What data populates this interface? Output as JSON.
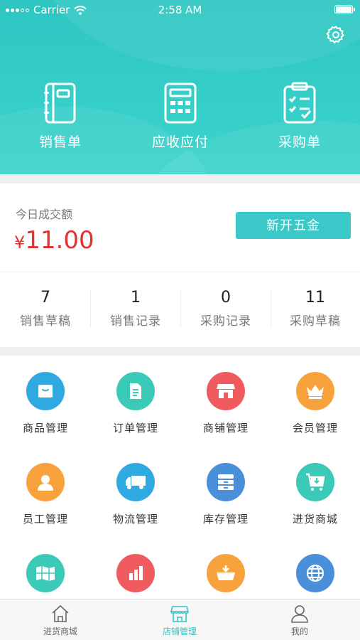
{
  "status_bar": {
    "carrier": "Carrier",
    "time": "2:58 AM"
  },
  "header": {
    "quick_actions": [
      {
        "label": "销售单",
        "icon": "notebook-icon"
      },
      {
        "label": "应收应付",
        "icon": "calculator-icon"
      },
      {
        "label": "采购单",
        "icon": "checklist-clipboard-icon"
      }
    ]
  },
  "today": {
    "label": "今日成交额",
    "currency": "¥",
    "amount": "11.00",
    "button_label": "新开五金"
  },
  "stats": [
    {
      "count": "7",
      "label": "销售草稿"
    },
    {
      "count": "1",
      "label": "销售记录"
    },
    {
      "count": "0",
      "label": "采购记录"
    },
    {
      "count": "11",
      "label": "采购草稿"
    }
  ],
  "features": [
    {
      "label": "商品管理",
      "color": "#2eaae0",
      "icon": "shopping-bag-icon"
    },
    {
      "label": "订单管理",
      "color": "#3ccab8",
      "icon": "document-icon"
    },
    {
      "label": "商铺管理",
      "color": "#f05b60",
      "icon": "storefront-icon"
    },
    {
      "label": "会员管理",
      "color": "#f7a23c",
      "icon": "crown-icon"
    },
    {
      "label": "员工管理",
      "color": "#f7a23c",
      "icon": "person-icon"
    },
    {
      "label": "物流管理",
      "color": "#2eaae0",
      "icon": "truck-icon"
    },
    {
      "label": "库存管理",
      "color": "#4a8fd9",
      "icon": "drawers-icon"
    },
    {
      "label": "进货商城",
      "color": "#3ccab8",
      "icon": "cart-download-icon"
    },
    {
      "label": "",
      "color": "#3ccab8",
      "icon": "map-icon"
    },
    {
      "label": "",
      "color": "#f05b60",
      "icon": "bar-chart-icon"
    },
    {
      "label": "",
      "color": "#f7a23c",
      "icon": "basket-icon"
    },
    {
      "label": "",
      "color": "#4a8fd9",
      "icon": "globe-icon"
    }
  ],
  "tabbar": {
    "active_color": "#35c3c1",
    "tabs": [
      {
        "label": "进货商城",
        "icon": "house-icon"
      },
      {
        "label": "店铺管理",
        "icon": "store-icon"
      },
      {
        "label": "我的",
        "icon": "user-icon"
      }
    ]
  }
}
